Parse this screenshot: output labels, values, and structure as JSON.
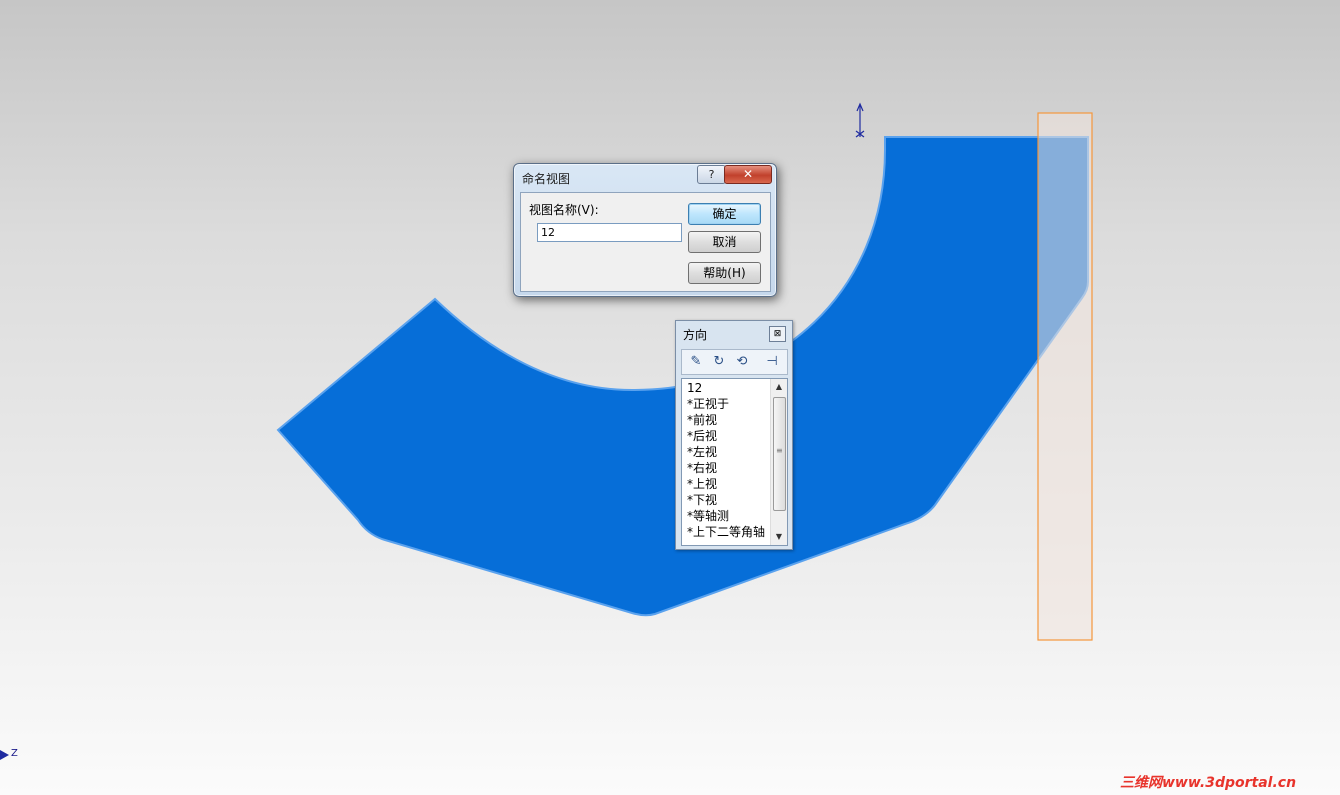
{
  "colors": {
    "part_fill": "#066ed8",
    "part_edge": "#5aa2ee",
    "plane_fill": "#f1e3dc",
    "plane_edge": "#f5973c",
    "triad": "#1f2ba0",
    "watermark": "#e8342c"
  },
  "name_view_dialog": {
    "title": "命名视图",
    "help_glyph": "?",
    "close_glyph": "✕",
    "field_label": "视图名称(V):",
    "field_value": "12",
    "ok_label": "确定",
    "cancel_label": "取消",
    "help_label": "帮助(H)"
  },
  "orientation_dialog": {
    "title": "方向",
    "close_glyph": "⊠",
    "toolbar_icons": [
      "new-view-icon",
      "update-standard-views-icon",
      "reset-standard-views-icon",
      "pin-dialog-icon"
    ],
    "views": [
      "12",
      "*正视于",
      "*前视",
      "*后视",
      "*左视",
      "*右视",
      "*上视",
      "*下视",
      "*等轴测",
      "*上下二等角轴测"
    ]
  },
  "axis_label": "Z",
  "watermark": "三维网www.3dportal.cn"
}
